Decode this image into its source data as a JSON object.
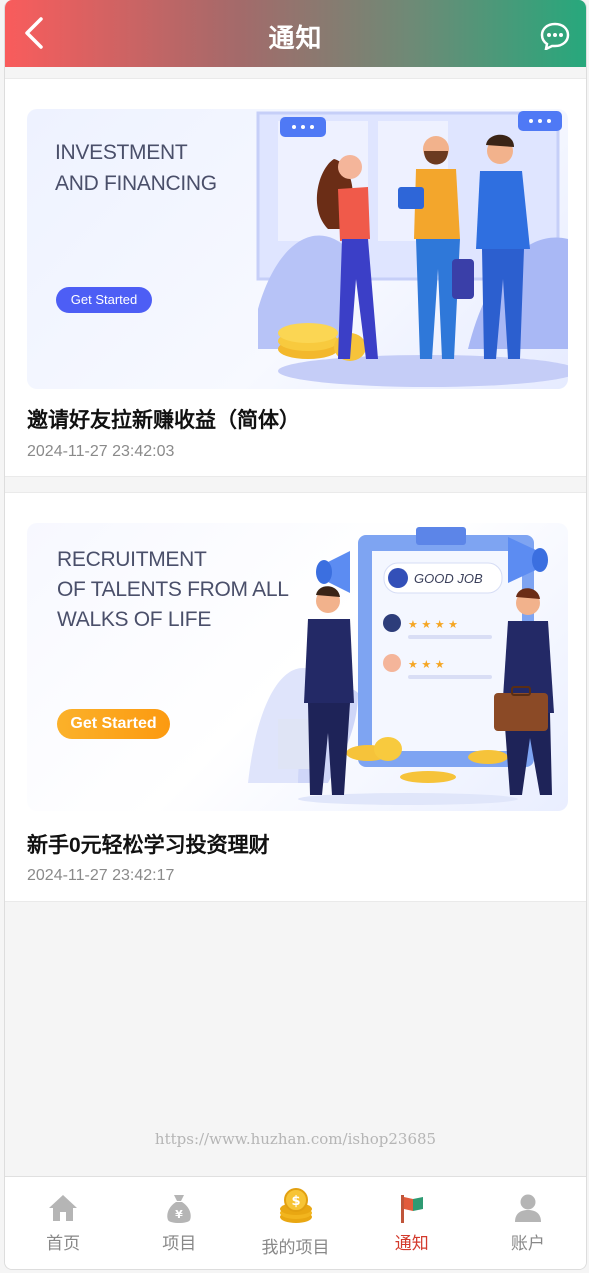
{
  "header": {
    "title": "通知",
    "back_icon": "chevron-left-icon",
    "message_icon": "chat-bubble-icon"
  },
  "notices": [
    {
      "banner_text": "INVESTMENT\nAND FINANCING",
      "banner_button": "Get Started",
      "title": "邀请好友拉新赚收益（简体）",
      "date": "2024-11-27 23:42:03"
    },
    {
      "banner_text": "RECRUITMENT\nOF TALENTS FROM ALL\nWALKS OF LIFE",
      "banner_button": "Get Started",
      "banner_badge": "GOOD JOB",
      "title": "新手0元轻松学习投资理财",
      "date": "2024-11-27 23:42:17"
    }
  ],
  "watermark": "https://www.huzhan.com/ishop23685",
  "tabbar": {
    "items": [
      {
        "label": "首页",
        "icon": "home-icon"
      },
      {
        "label": "项目",
        "icon": "money-bag-icon"
      },
      {
        "label": "我的项目",
        "icon": "coins-icon"
      },
      {
        "label": "通知",
        "icon": "flag-icon"
      },
      {
        "label": "账户",
        "icon": "user-icon"
      }
    ],
    "active": "通知",
    "active_color": "#d33a2c",
    "inactive_color": "#888888"
  },
  "colors": {
    "header_gradient_start": "#f95c5c",
    "header_gradient_end": "#27a87c",
    "banner1_button": "#4d5ef5",
    "banner2_button": "#fca41a"
  }
}
